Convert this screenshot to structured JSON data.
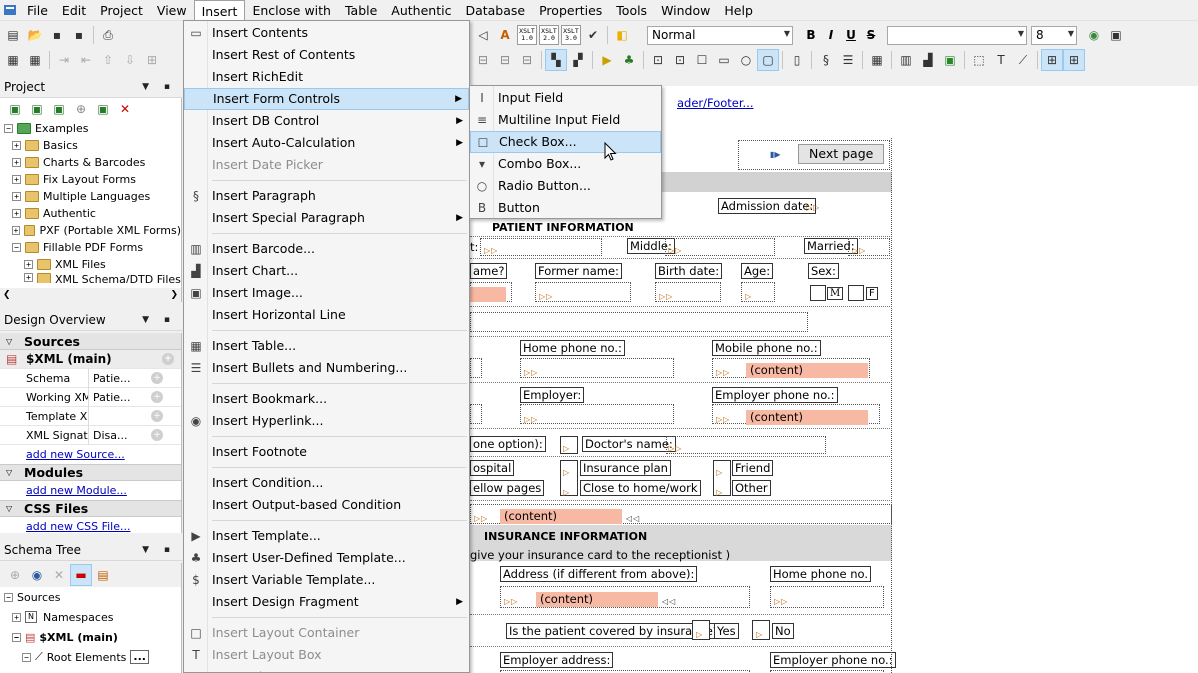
{
  "menubar": {
    "items": [
      "File",
      "Edit",
      "Project",
      "View",
      "Insert",
      "Enclose with",
      "Table",
      "Authentic",
      "Database",
      "Properties",
      "Tools",
      "Window",
      "Help"
    ],
    "active": "Insert"
  },
  "toolbar": {
    "style_value": "Normal",
    "size_value": "8",
    "xslt": [
      "XSLT 1.0",
      "XSLT 2.0",
      "XSLT 3.0"
    ],
    "bold": "B",
    "italic": "I",
    "underline": "U",
    "strike": "S"
  },
  "project": {
    "title": "Project",
    "tree": [
      {
        "label": "Examples",
        "level": 0
      },
      {
        "label": "Basics",
        "level": 1
      },
      {
        "label": "Charts & Barcodes",
        "level": 1
      },
      {
        "label": "Fix Layout Forms",
        "level": 1
      },
      {
        "label": "Multiple Languages",
        "level": 1
      },
      {
        "label": "Authentic",
        "level": 1
      },
      {
        "label": "PXF (Portable XML Forms)",
        "level": 1
      },
      {
        "label": "Fillable PDF Forms",
        "level": 1
      },
      {
        "label": "XML Files",
        "level": 2
      },
      {
        "label": "XML Schema/DTD Files",
        "level": 2
      }
    ]
  },
  "design_overview": {
    "title": "Design Overview",
    "sources_label": "Sources",
    "main_label": "$XML (main)",
    "rows": [
      {
        "k": "Schema",
        "v": "Patie..."
      },
      {
        "k": "Working XML",
        "v": "Patie..."
      },
      {
        "k": "Template XML",
        "v": ""
      },
      {
        "k": "XML Signature",
        "v": "Disa..."
      }
    ],
    "add_source": "add new Source...",
    "modules_label": "Modules",
    "add_module": "add new Module...",
    "css_label": "CSS Files",
    "add_css": "add new CSS File..."
  },
  "schema_tree": {
    "title": "Schema Tree",
    "rows": [
      "Sources",
      "Namespaces",
      "$XML (main)",
      "Root Elements"
    ]
  },
  "insert_menu": [
    {
      "label": "Insert Contents",
      "icon": "contents-icon",
      "disabled": false
    },
    {
      "label": "Insert Rest of Contents",
      "disabled": false
    },
    {
      "label": "Insert RichEdit",
      "disabled": false
    },
    {
      "label": "Insert Form Controls",
      "disabled": false,
      "sub": true,
      "hl": true
    },
    {
      "label": "Insert DB Control",
      "disabled": false,
      "sub": true
    },
    {
      "label": "Insert Auto-Calculation",
      "disabled": false,
      "sub": true
    },
    {
      "label": "Insert Date Picker",
      "disabled": true
    },
    {
      "sep": true
    },
    {
      "label": "Insert Paragraph",
      "icon": "paragraph-icon",
      "glyph": "§",
      "disabled": false
    },
    {
      "label": "Insert Special Paragraph",
      "disabled": false,
      "sub": true
    },
    {
      "sep": true
    },
    {
      "label": "Insert Barcode...",
      "icon": "barcode-icon",
      "glyph": "▥",
      "disabled": false
    },
    {
      "label": "Insert Chart...",
      "icon": "chart-icon",
      "glyph": "▟",
      "disabled": false
    },
    {
      "label": "Insert Image...",
      "icon": "image-icon",
      "glyph": "▣",
      "disabled": false
    },
    {
      "label": "Insert Horizontal Line",
      "disabled": false
    },
    {
      "sep": true
    },
    {
      "label": "Insert Table...",
      "icon": "table-icon",
      "glyph": "▦",
      "disabled": false
    },
    {
      "label": "Insert Bullets and Numbering...",
      "icon": "bullets-icon",
      "glyph": "☰",
      "disabled": false
    },
    {
      "sep": true
    },
    {
      "label": "Insert Bookmark...",
      "disabled": false
    },
    {
      "label": "Insert Hyperlink...",
      "icon": "hyperlink-icon",
      "glyph": "◉",
      "disabled": false
    },
    {
      "sep": true
    },
    {
      "label": "Insert Footnote",
      "disabled": false
    },
    {
      "sep": true
    },
    {
      "label": "Insert Condition...",
      "disabled": false
    },
    {
      "label": "Insert Output-based Condition",
      "disabled": false
    },
    {
      "sep": true
    },
    {
      "label": "Insert Template...",
      "icon": "template-icon",
      "glyph": "▶",
      "disabled": false
    },
    {
      "label": "Insert User-Defined Template...",
      "icon": "user-template-icon",
      "glyph": "♣",
      "disabled": false
    },
    {
      "label": "Insert Variable Template...",
      "icon": "variable-template-icon",
      "glyph": "$",
      "disabled": false
    },
    {
      "label": "Insert Design Fragment",
      "disabled": false,
      "sub": true
    },
    {
      "sep": true
    },
    {
      "label": "Insert Layout Container",
      "icon": "layout-container-icon",
      "glyph": "□",
      "disabled": true
    },
    {
      "label": "Insert Layout Box",
      "icon": "layout-box-icon",
      "glyph": "T",
      "disabled": true
    },
    {
      "label": "Insert Line",
      "icon": "line-icon",
      "glyph": "/",
      "disabled": true
    }
  ],
  "form_controls_menu": [
    {
      "label": "Input Field",
      "icon": "input-field-icon",
      "glyph": "I"
    },
    {
      "label": "Multiline Input Field",
      "icon": "multiline-input-icon",
      "glyph": "≡"
    },
    {
      "label": "Check Box...",
      "icon": "checkbox-icon",
      "glyph": "☐",
      "hl": true
    },
    {
      "label": "Combo Box...",
      "icon": "combobox-icon",
      "glyph": "▾"
    },
    {
      "label": "Radio Button...",
      "icon": "radio-button-icon",
      "glyph": "○"
    },
    {
      "label": "Button",
      "icon": "button-icon",
      "glyph": "B"
    }
  ],
  "document": {
    "header_footer_link": "ader/Footer...",
    "next_page": "Next page",
    "admission_date": "Admission date:",
    "patient_information": "PATIENT INFORMATION",
    "middle": "Middle:",
    "married": "Married:",
    "name_label": "ame?",
    "former_name": "Former name:",
    "birth_date": "Birth date:",
    "age": "Age:",
    "sex": "Sex:",
    "sex_m": "M",
    "sex_f": "F",
    "home_phone": "Home phone no.:",
    "mobile_phone": "Mobile phone no.:",
    "content": "(content)",
    "employer": "Employer:",
    "employer_phone": "Employer phone no.:",
    "one_option": "one option):",
    "doctors_name": "Doctor's name:",
    "hospital": "ospital",
    "insurance_plan": "Insurance plan",
    "friend": "Friend",
    "yellow_pages": "ellow pages",
    "close_to_home": "Close to home/work",
    "other": "Other",
    "insurance_information": "INSURANCE INFORMATION",
    "insurance_note": "give your insurance card to the receptionist )",
    "address_diff": "Address (if different from above):",
    "home_phone2": "Home phone no.",
    "covered_q": "Is the patient covered by insurance?",
    "yes": "Yes",
    "no": "No",
    "employer_address": "Employer address:",
    "employer_phone2": "Employer phone no.:"
  }
}
